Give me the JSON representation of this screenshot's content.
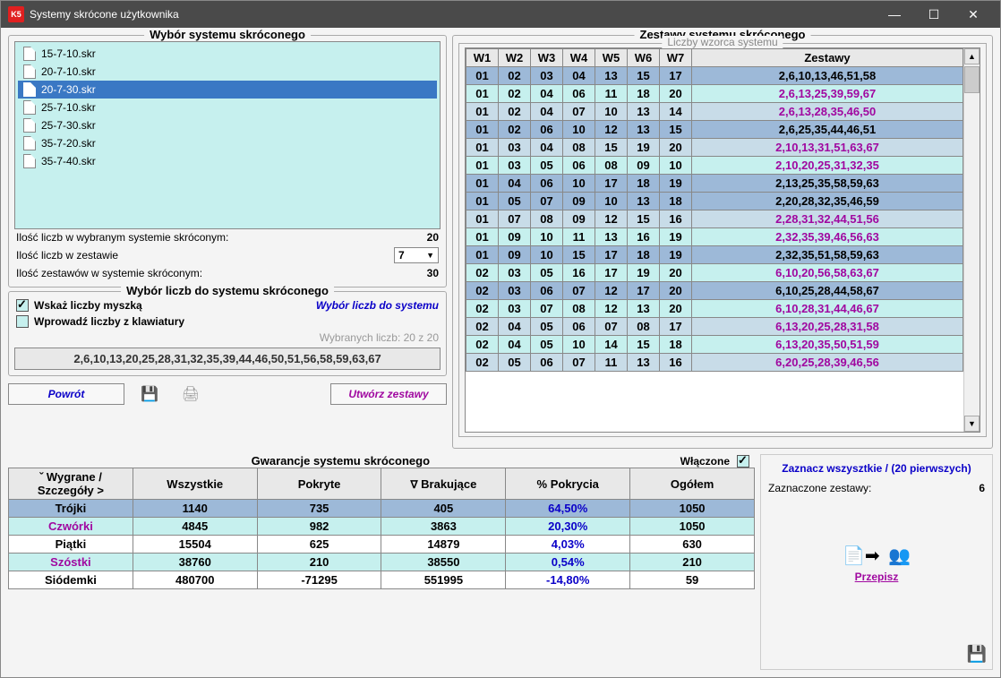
{
  "title": "Systemy skrócone użytkownika",
  "icon_text": "K5",
  "fs1": {
    "legend": "Wybór systemu skróconego",
    "files": [
      "15-7-10.skr",
      "20-7-10.skr",
      "20-7-30.skr",
      "25-7-10.skr",
      "25-7-30.skr",
      "35-7-20.skr",
      "35-7-40.skr"
    ],
    "selected": 2,
    "r1l": "Ilość liczb w wybranym systemie skróconym:",
    "r1v": "20",
    "r2l": "Ilość liczb w zestawie",
    "r2v": "7",
    "r3l": "Ilość zestawów w systemie skróconym:",
    "r3v": "30"
  },
  "fs2": {
    "legend": "Wybór liczb do systemu skróconego",
    "cb1": "Wskaż liczby myszką",
    "link": "Wybór liczb do systemu",
    "cb2": "Wprowadź liczby z klawiatury",
    "chosen": "Wybranych liczb: 20 z 20",
    "nums": "2,6,10,13,20,25,28,31,32,35,39,44,46,50,51,56,58,59,63,67"
  },
  "toolbar": {
    "back": "Powrót",
    "create": "Utwórz zestawy"
  },
  "fs3": {
    "legend": "Zestawy systemu skróconego",
    "sublegend": "Liczby wzorca systemu",
    "headers": [
      "W1",
      "W2",
      "W3",
      "W4",
      "W5",
      "W6",
      "W7",
      "Zestawy"
    ],
    "rows": [
      {
        "w": [
          "01",
          "02",
          "03",
          "04",
          "13",
          "15",
          "17"
        ],
        "z": "2,6,10,13,46,51,58",
        "c": "black",
        "sel": true
      },
      {
        "w": [
          "01",
          "02",
          "04",
          "06",
          "11",
          "18",
          "20"
        ],
        "z": "2,6,13,25,39,59,67",
        "c": "purple"
      },
      {
        "w": [
          "01",
          "02",
          "04",
          "07",
          "10",
          "13",
          "14"
        ],
        "z": "2,6,13,28,35,46,50",
        "c": "purple"
      },
      {
        "w": [
          "01",
          "02",
          "06",
          "10",
          "12",
          "13",
          "15"
        ],
        "z": "2,6,25,35,44,46,51",
        "c": "black",
        "sel": true
      },
      {
        "w": [
          "01",
          "03",
          "04",
          "08",
          "15",
          "19",
          "20"
        ],
        "z": "2,10,13,31,51,63,67",
        "c": "purple"
      },
      {
        "w": [
          "01",
          "03",
          "05",
          "06",
          "08",
          "09",
          "10"
        ],
        "z": "2,10,20,25,31,32,35",
        "c": "purple"
      },
      {
        "w": [
          "01",
          "04",
          "06",
          "10",
          "17",
          "18",
          "19"
        ],
        "z": "2,13,25,35,58,59,63",
        "c": "black",
        "sel": true
      },
      {
        "w": [
          "01",
          "05",
          "07",
          "09",
          "10",
          "13",
          "18"
        ],
        "z": "2,20,28,32,35,46,59",
        "c": "black",
        "sel": true
      },
      {
        "w": [
          "01",
          "07",
          "08",
          "09",
          "12",
          "15",
          "16"
        ],
        "z": "2,28,31,32,44,51,56",
        "c": "purple"
      },
      {
        "w": [
          "01",
          "09",
          "10",
          "11",
          "13",
          "16",
          "19"
        ],
        "z": "2,32,35,39,46,56,63",
        "c": "purple"
      },
      {
        "w": [
          "01",
          "09",
          "10",
          "15",
          "17",
          "18",
          "19"
        ],
        "z": "2,32,35,51,58,59,63",
        "c": "black",
        "sel": true
      },
      {
        "w": [
          "02",
          "03",
          "05",
          "16",
          "17",
          "19",
          "20"
        ],
        "z": "6,10,20,56,58,63,67",
        "c": "purple"
      },
      {
        "w": [
          "02",
          "03",
          "06",
          "07",
          "12",
          "17",
          "20"
        ],
        "z": "6,10,25,28,44,58,67",
        "c": "black",
        "sel": true
      },
      {
        "w": [
          "02",
          "03",
          "07",
          "08",
          "12",
          "13",
          "20"
        ],
        "z": "6,10,28,31,44,46,67",
        "c": "purple"
      },
      {
        "w": [
          "02",
          "04",
          "05",
          "06",
          "07",
          "08",
          "17"
        ],
        "z": "6,13,20,25,28,31,58",
        "c": "purple"
      },
      {
        "w": [
          "02",
          "04",
          "05",
          "10",
          "14",
          "15",
          "18"
        ],
        "z": "6,13,20,35,50,51,59",
        "c": "purple"
      },
      {
        "w": [
          "02",
          "05",
          "06",
          "07",
          "11",
          "13",
          "16"
        ],
        "z": "6,20,25,28,39,46,56",
        "c": "purple"
      }
    ]
  },
  "guar": {
    "legend": "Gwarancje systemu skróconego",
    "enabled_label": "Włączone",
    "headers": [
      "ˇ Wygrane / Szczegóły >",
      "Wszystkie",
      "Pokryte",
      "Brakujące",
      "% Pokrycia",
      "Ogółem"
    ],
    "filter_icon": "∇",
    "rows": [
      {
        "n": "Trójki",
        "v": [
          "1140",
          "735",
          "405",
          "64,50%",
          "1050"
        ],
        "c": "black",
        "hl": true
      },
      {
        "n": "Czwórki",
        "v": [
          "4845",
          "982",
          "3863",
          "20,30%",
          "1050"
        ],
        "c": "purple"
      },
      {
        "n": "Piątki",
        "v": [
          "15504",
          "625",
          "14879",
          "4,03%",
          "630"
        ],
        "c": "black"
      },
      {
        "n": "Szóstki",
        "v": [
          "38760",
          "210",
          "38550",
          "0,54%",
          "210"
        ],
        "c": "purple"
      },
      {
        "n": "Siódemki",
        "v": [
          "480700",
          "-71295",
          "551995",
          "-14,80%",
          "59"
        ],
        "c": "black"
      }
    ]
  },
  "side": {
    "mark": "Zaznacz wszysztkie / (20 pierwszych)",
    "lbl": "Zaznaczone zestawy:",
    "val": "6",
    "przep": "Przepisz"
  }
}
